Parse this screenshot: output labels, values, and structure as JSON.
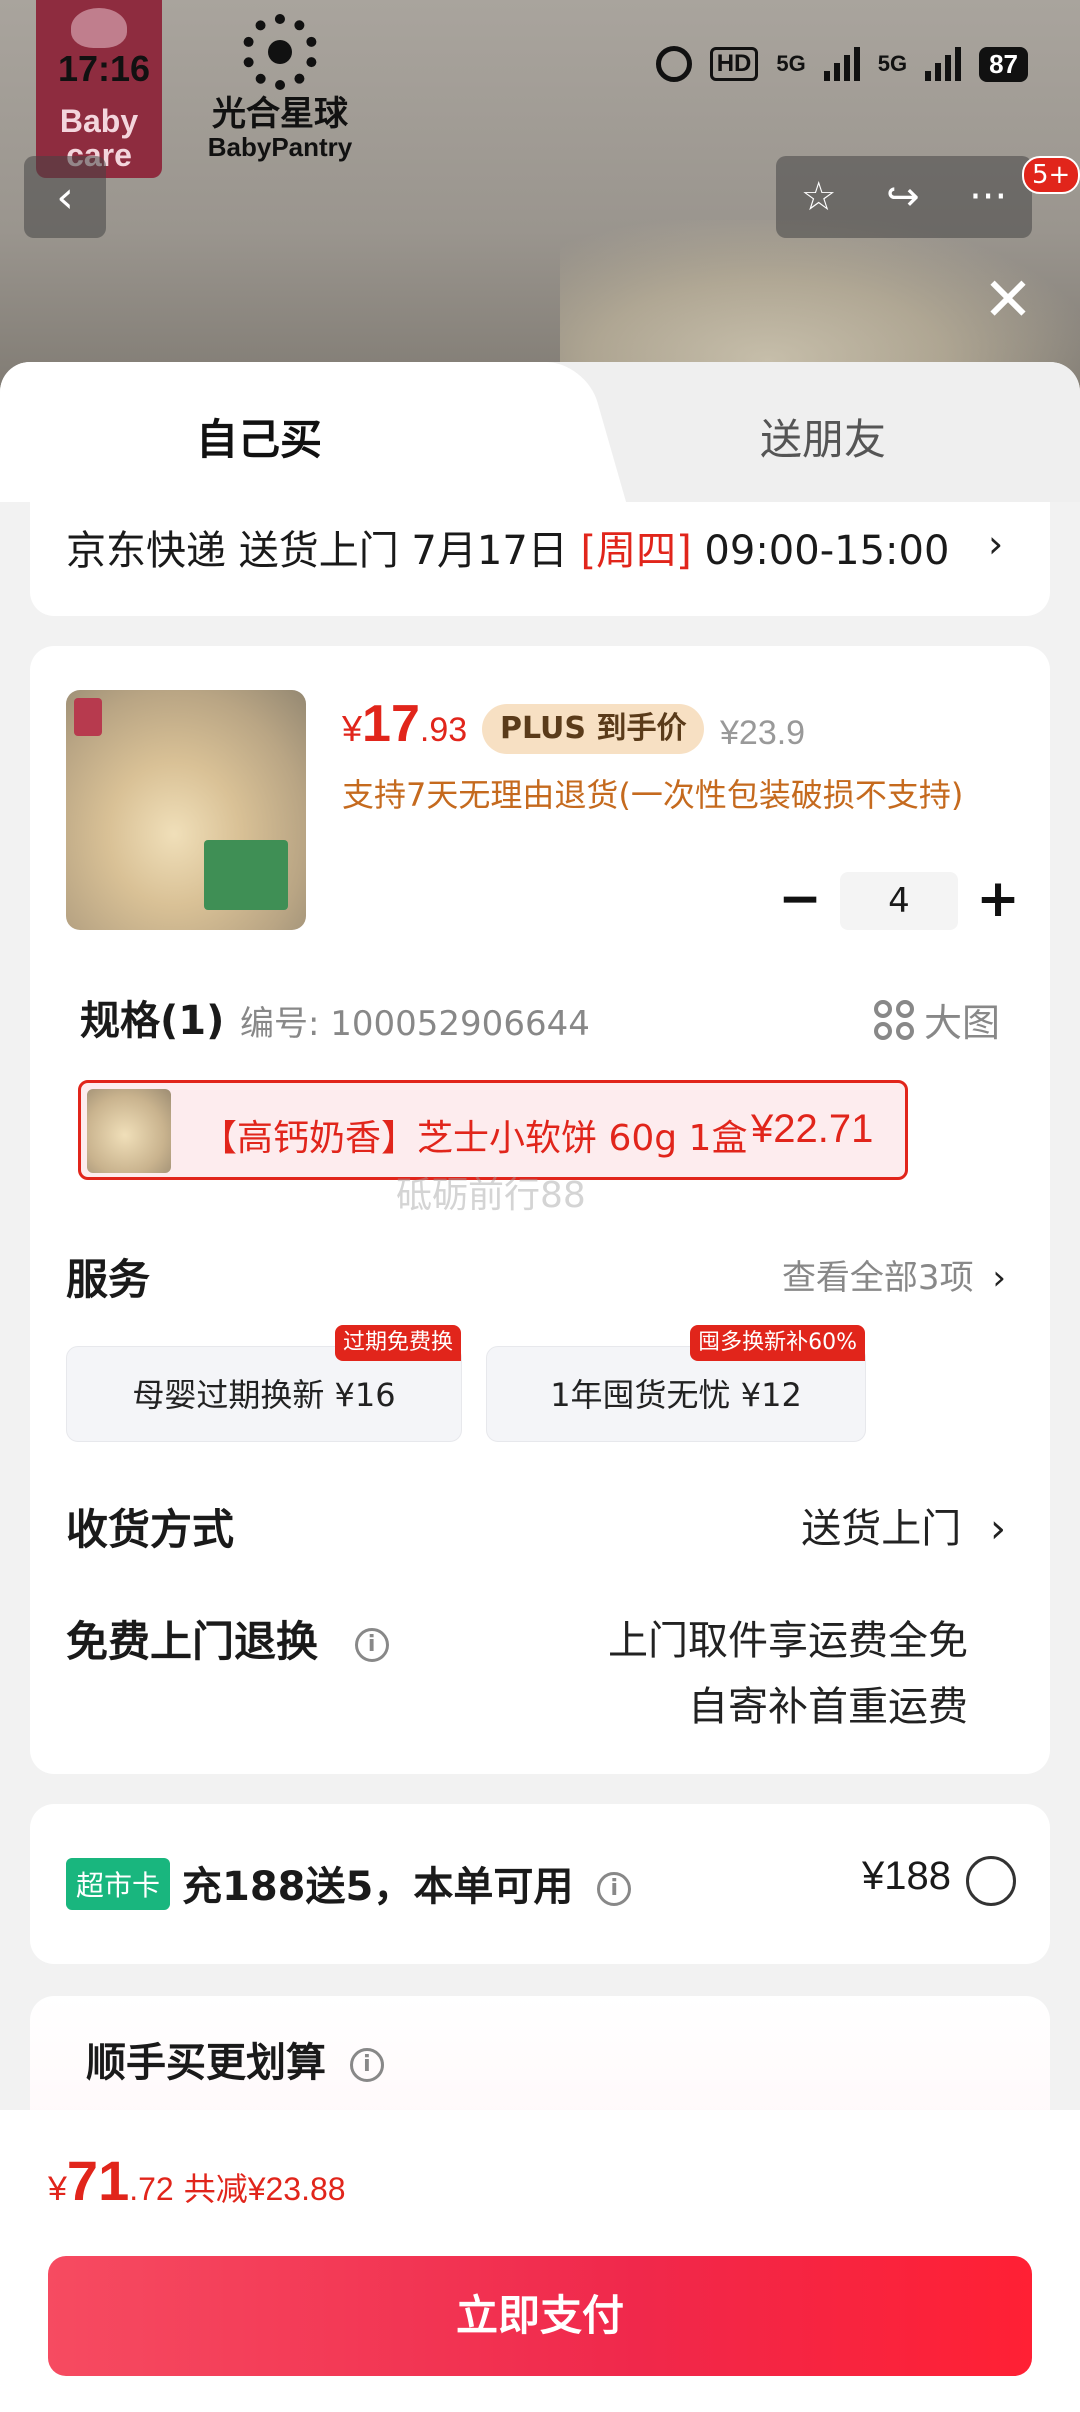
{
  "status_bar": {
    "time": "17:16",
    "hd": "HD",
    "sig1": "5G",
    "sig2": "5G",
    "battery": "87"
  },
  "brands": {
    "brand1_line1": "Baby",
    "brand1_line2": "care",
    "brand2_cn": "光合星球",
    "brand2_en": "BabyPantry"
  },
  "nav": {
    "back": "‹",
    "star": "☆",
    "share": "↪",
    "more": "···",
    "badge": "5+",
    "close": "✕"
  },
  "tabs": {
    "self_buy": "自己买",
    "gift": "送朋友"
  },
  "delivery": {
    "prefix": "京东快递 送货上门 7月17日 ",
    "weekday": "[周四]",
    "time": " 09:00-15:00",
    "chevron": "›"
  },
  "product": {
    "price_currency": "¥",
    "price_int": "17",
    "price_dec": ".93",
    "plus_tag": "PLUS 到手价",
    "orig_price": "¥23.9",
    "return_note": "支持7天无理由退货(一次性包装破损不支持)",
    "qty_minus": "−",
    "quantity": "4",
    "qty_plus": "+"
  },
  "spec": {
    "title": "规格(1)",
    "code": "编号: 100052906644",
    "bigimg": "大图",
    "chip_name": "【高钙奶香】芝士小软饼 60g 1盒",
    "chip_price": "¥22.71",
    "watermark": "砥砺前行88"
  },
  "service": {
    "title": "服务",
    "view_all": "查看全部3项",
    "chevron": "›",
    "items": [
      {
        "label": "母婴过期换新  ¥16",
        "tag": "过期免费换"
      },
      {
        "label": "1年囤货无忧  ¥12",
        "tag": "囤多换新补60%"
      }
    ]
  },
  "shipping": {
    "title": "收货方式",
    "value": "送货上门",
    "chevron": "›"
  },
  "return_service": {
    "title": "免费上门退换",
    "info": "i",
    "line1": "上门取件享运费全免",
    "line2": "自寄补首重运费"
  },
  "card": {
    "chip": "超市卡",
    "text": "充188送5，本单可用",
    "info": "i",
    "price": "¥188"
  },
  "more_buy": {
    "title": "顺手买更划算",
    "info": "i"
  },
  "total": {
    "currency": "¥",
    "int": "71",
    "dec": ".72",
    "save": "共减¥23.88"
  },
  "pay_button": "立即支付",
  "colors": {
    "accent": "#e1251b",
    "plus_bg": "#f7e0c3",
    "green_chip": "#19b67e"
  }
}
